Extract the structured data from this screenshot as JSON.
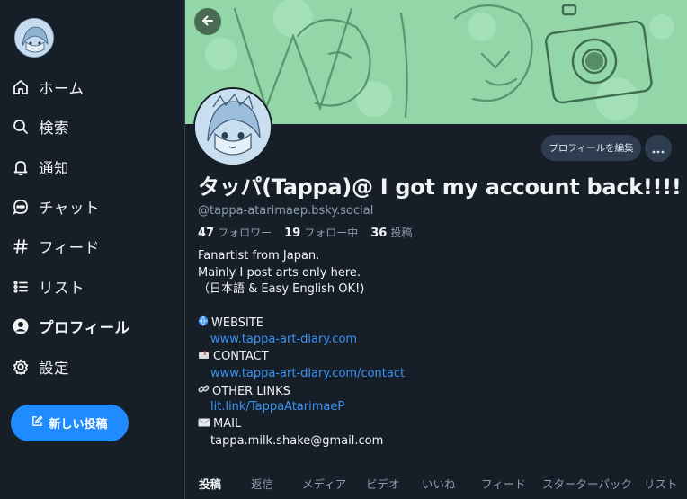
{
  "sidebar": {
    "items": [
      {
        "label": "ホーム",
        "icon": "home-icon"
      },
      {
        "label": "検索",
        "icon": "search-icon"
      },
      {
        "label": "通知",
        "icon": "bell-icon"
      },
      {
        "label": "チャット",
        "icon": "chat-icon"
      },
      {
        "label": "フィード",
        "icon": "hash-icon"
      },
      {
        "label": "リスト",
        "icon": "list-icon"
      },
      {
        "label": "プロフィール",
        "icon": "person-icon"
      },
      {
        "label": "設定",
        "icon": "gear-icon"
      }
    ],
    "new_post_label": "新しい投稿"
  },
  "profile": {
    "edit_label": "プロフィールを編集",
    "display_name": "タッパ(Tappa)@ I got my account back!!!!",
    "handle": "@tappa-atarimaep.bsky.social",
    "followers_count": "47",
    "followers_label": "フォロワー",
    "following_count": "19",
    "following_label": "フォロー中",
    "posts_count": "36",
    "posts_label": "投稿",
    "bio": {
      "line1": "Fanartist from Japan.",
      "line2": "Mainly I post arts only here.",
      "line3": "（日本語 & Easy English OK!)",
      "website_label": "WEBSITE",
      "website_url": "www.tappa-art-diary.com",
      "contact_label": "CONTACT",
      "contact_url": "www.tappa-art-diary.com/contact",
      "links_label": "OTHER LINKS",
      "links_url": "lit.link/TappaAtarimaeP",
      "mail_label": "MAIL",
      "mail_address": "tappa.milk.shake@gmail.com"
    }
  },
  "tabs": [
    "投稿",
    "返信",
    "メディア",
    "ビデオ",
    "いいね",
    "フィード",
    "スターターパック",
    "リスト"
  ],
  "colors": {
    "background": "#161e27",
    "accent": "#208bfe",
    "link": "#3a93f5",
    "muted": "#8c9db0",
    "banner": "#93d6a8"
  }
}
